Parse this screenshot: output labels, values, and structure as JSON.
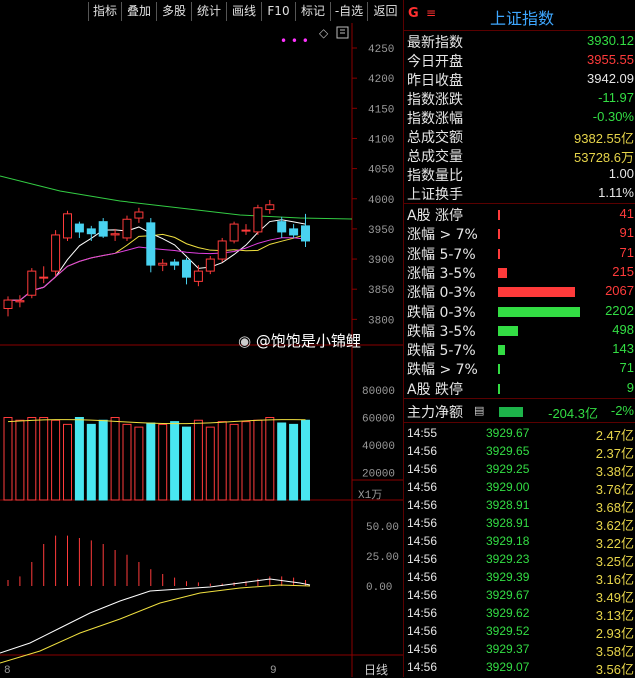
{
  "toolbar": {
    "buttons": [
      "指标",
      "叠加",
      "多股",
      "统计",
      "画线",
      "F10",
      "标记",
      "-自选",
      "返回"
    ]
  },
  "chart": {
    "price_ticks": [
      "4250",
      "4200",
      "4150",
      "4100",
      "4050",
      "4000",
      "3950",
      "3900",
      "3850",
      "3800"
    ],
    "volume_ticks": [
      "80000",
      "60000",
      "40000",
      "20000"
    ],
    "volume_unit": "X1万",
    "macd_ticks": [
      "50.00",
      "25.00",
      "0.00"
    ],
    "x_labels": [
      "8",
      "9"
    ],
    "period_label": "日线",
    "watermark": "@饱饱是小锦鲤"
  },
  "chart_data": {
    "type": "candlestick",
    "candles": [
      {
        "o": 3818,
        "c": 3832,
        "h": 3838,
        "l": 3805
      },
      {
        "o": 3829,
        "c": 3831,
        "h": 3840,
        "l": 3820
      },
      {
        "o": 3840,
        "c": 3880,
        "h": 3885,
        "l": 3835
      },
      {
        "o": 3870,
        "c": 3870,
        "h": 3888,
        "l": 3860
      },
      {
        "o": 3880,
        "c": 3940,
        "h": 3948,
        "l": 3872
      },
      {
        "o": 3935,
        "c": 3975,
        "h": 3980,
        "l": 3930
      },
      {
        "o": 3958,
        "c": 3945,
        "h": 3962,
        "l": 3935
      },
      {
        "o": 3950,
        "c": 3942,
        "h": 3955,
        "l": 3930
      },
      {
        "o": 3962,
        "c": 3938,
        "h": 3968,
        "l": 3935
      },
      {
        "o": 3940,
        "c": 3942,
        "h": 3950,
        "l": 3930
      },
      {
        "o": 3935,
        "c": 3966,
        "h": 3972,
        "l": 3930
      },
      {
        "o": 3968,
        "c": 3978,
        "h": 3985,
        "l": 3960
      },
      {
        "o": 3960,
        "c": 3890,
        "h": 3968,
        "l": 3878
      },
      {
        "o": 3890,
        "c": 3893,
        "h": 3900,
        "l": 3880
      },
      {
        "o": 3895,
        "c": 3890,
        "h": 3900,
        "l": 3882
      },
      {
        "o": 3898,
        "c": 3870,
        "h": 3902,
        "l": 3858
      },
      {
        "o": 3863,
        "c": 3880,
        "h": 3890,
        "l": 3855
      },
      {
        "o": 3880,
        "c": 3900,
        "h": 3905,
        "l": 3875
      },
      {
        "o": 3900,
        "c": 3930,
        "h": 3935,
        "l": 3895
      },
      {
        "o": 3930,
        "c": 3958,
        "h": 3962,
        "l": 3926
      },
      {
        "o": 3948,
        "c": 3948,
        "h": 3958,
        "l": 3940
      },
      {
        "o": 3945,
        "c": 3985,
        "h": 3990,
        "l": 3940
      },
      {
        "o": 3982,
        "c": 3990,
        "h": 3998,
        "l": 3975
      },
      {
        "o": 3962,
        "c": 3945,
        "h": 3970,
        "l": 3935
      },
      {
        "o": 3950,
        "c": 3940,
        "h": 3958,
        "l": 3935
      },
      {
        "o": 3955,
        "c": 3930,
        "h": 3975,
        "l": 3920
      }
    ],
    "volume": [
      60000,
      58000,
      60000,
      60000,
      58000,
      55000,
      60000,
      55000,
      58000,
      60000,
      55000,
      53000,
      56000,
      55000,
      57000,
      53000,
      58000,
      53000,
      57000,
      55000,
      57000,
      58000,
      60000,
      56000,
      55000,
      58000
    ],
    "macd_hist": [
      5,
      8,
      20,
      35,
      42,
      42,
      40,
      38,
      35,
      30,
      26,
      20,
      14,
      10,
      7,
      4,
      3,
      2,
      2,
      3,
      4,
      6,
      8,
      8,
      7,
      5
    ]
  },
  "panel": {
    "title": "上证指数",
    "badge_g": "G",
    "menu_icon": "≡",
    "stats": [
      {
        "k": "最新指数",
        "v": "3930.12",
        "c": "#33dd44"
      },
      {
        "k": "今日开盘",
        "v": "3955.55",
        "c": "#ff3b3b"
      },
      {
        "k": "昨日收盘",
        "v": "3942.09",
        "c": "#e6e6e6"
      },
      {
        "k": "指数涨跌",
        "v": "-11.97",
        "c": "#33dd44"
      },
      {
        "k": "指数涨幅",
        "v": "-0.30%",
        "c": "#33dd44"
      },
      {
        "k": "总成交额",
        "v": "9382.55亿",
        "c": "#e6d44a"
      },
      {
        "k": "总成交量",
        "v": "53728.6万",
        "c": "#e6d44a"
      },
      {
        "k": "指数量比",
        "v": "1.00",
        "c": "#e6e6e6"
      },
      {
        "k": "上证换手",
        "v": "1.11%",
        "c": "#e6e6e6"
      }
    ],
    "dist": [
      {
        "k": "A股 涨停",
        "v": "41",
        "c": "#ff3b3b",
        "frac": 0.012
      },
      {
        "k": "涨幅 > 7%",
        "v": "91",
        "c": "#ff3b3b",
        "frac": 0.025
      },
      {
        "k": "涨幅 5-7%",
        "v": "71",
        "c": "#ff3b3b",
        "frac": 0.02
      },
      {
        "k": "涨幅 3-5%",
        "v": "215",
        "c": "#ff3b3b",
        "frac": 0.11
      },
      {
        "k": "涨幅 0-3%",
        "v": "2067",
        "c": "#ff3b3b",
        "frac": 0.94
      },
      {
        "k": "跌幅 0-3%",
        "v": "2202",
        "c": "#33dd44",
        "frac": 1.0
      },
      {
        "k": "跌幅 3-5%",
        "v": "498",
        "c": "#33dd44",
        "frac": 0.24
      },
      {
        "k": "跌幅 5-7%",
        "v": "143",
        "c": "#33dd44",
        "frac": 0.08
      },
      {
        "k": "跌幅 > 7%",
        "v": "71",
        "c": "#33dd44",
        "frac": 0.03
      },
      {
        "k": "A股 跌停",
        "v": "9",
        "c": "#33dd44",
        "frac": 0.01
      }
    ],
    "main_flow": {
      "k": "主力净额",
      "v": "-204.3亿",
      "pct": "-2%"
    },
    "ticks": [
      {
        "t": "14:55",
        "p": "3929.67",
        "v": "2.47亿"
      },
      {
        "t": "14:56",
        "p": "3929.65",
        "v": "2.37亿"
      },
      {
        "t": "14:56",
        "p": "3929.25",
        "v": "3.38亿"
      },
      {
        "t": "14:56",
        "p": "3929.00",
        "v": "3.76亿"
      },
      {
        "t": "14:56",
        "p": "3928.91",
        "v": "3.68亿"
      },
      {
        "t": "14:56",
        "p": "3928.91",
        "v": "3.62亿"
      },
      {
        "t": "14:56",
        "p": "3929.18",
        "v": "3.22亿"
      },
      {
        "t": "14:56",
        "p": "3929.23",
        "v": "3.25亿"
      },
      {
        "t": "14:56",
        "p": "3929.39",
        "v": "3.16亿"
      },
      {
        "t": "14:56",
        "p": "3929.67",
        "v": "3.49亿"
      },
      {
        "t": "14:56",
        "p": "3929.62",
        "v": "3.13亿"
      },
      {
        "t": "14:56",
        "p": "3929.52",
        "v": "2.93亿"
      },
      {
        "t": "14:56",
        "p": "3929.37",
        "v": "3.58亿"
      },
      {
        "t": "14:56",
        "p": "3929.07",
        "v": "3.56亿"
      }
    ]
  }
}
